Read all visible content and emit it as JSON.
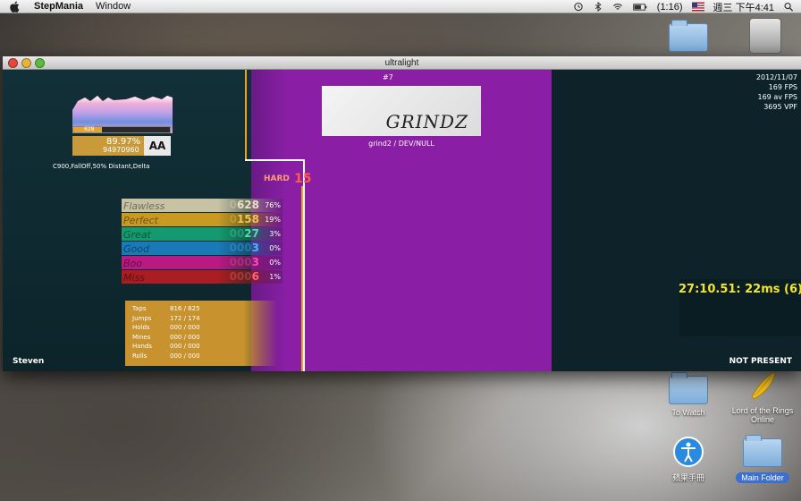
{
  "menubar": {
    "app": "StepMania",
    "items": [
      "Window"
    ],
    "battery": "(1:16)",
    "clock": "週三 下午4:41"
  },
  "window": {
    "title": "ultralight"
  },
  "game": {
    "rank": "#7",
    "banner_title": "GRINDZ",
    "song_subtitle": "grind2 / DEV/NULL",
    "difficulty": "HARD",
    "meter": "15",
    "fps": [
      "2012/11/07",
      "169 FPS",
      "169 av FPS",
      "3695 VPF"
    ],
    "life_value": "628",
    "life_level": 0.3,
    "score_percent": "89.97%",
    "score_points": "94970960",
    "grade": "AA",
    "modifiers": "C900,FallOff,50% Distant,Delta",
    "judgments": [
      {
        "name": "Flawless",
        "count_dim": "0",
        "count": "628",
        "pct": "76%",
        "color": "#e8e2c0",
        "bg": "#c8c2a4"
      },
      {
        "name": "Perfect",
        "count_dim": "0",
        "count": "158",
        "pct": "19%",
        "color": "#f3c64a",
        "bg": "#c99a22"
      },
      {
        "name": "Great",
        "count_dim": "00",
        "count": "27",
        "pct": "3%",
        "color": "#4de0a8",
        "bg": "#149a6e"
      },
      {
        "name": "Good",
        "count_dim": "000",
        "count": "3",
        "pct": "0%",
        "color": "#45b8ff",
        "bg": "#1a7ab8"
      },
      {
        "name": "Boo",
        "count_dim": "000",
        "count": "3",
        "pct": "0%",
        "color": "#ff4ab8",
        "bg": "#b81a82"
      },
      {
        "name": "Miss",
        "count_dim": "000",
        "count": "6",
        "pct": "1%",
        "color": "#ff6a5a",
        "bg": "#a81e22"
      }
    ],
    "stats": [
      {
        "label": "Taps",
        "value": "816 / 825"
      },
      {
        "label": "Jumps",
        "value": "172 / 174"
      },
      {
        "label": "Holds",
        "value": "000 / 000"
      },
      {
        "label": "Mines",
        "value": "000 / 000"
      },
      {
        "label": "Hands",
        "value": "000 / 000"
      },
      {
        "label": "Rolls",
        "value": "000 / 000"
      }
    ],
    "player_name": "Steven",
    "p2_status": "NOT PRESENT",
    "timing": "27:10.51: 22ms (6)"
  },
  "desktop": {
    "icons": [
      {
        "name": "To Watch"
      },
      {
        "name": "Lord of the Rings Online"
      },
      {
        "name": "蘋果手冊"
      },
      {
        "name": "Main Folder"
      }
    ]
  }
}
